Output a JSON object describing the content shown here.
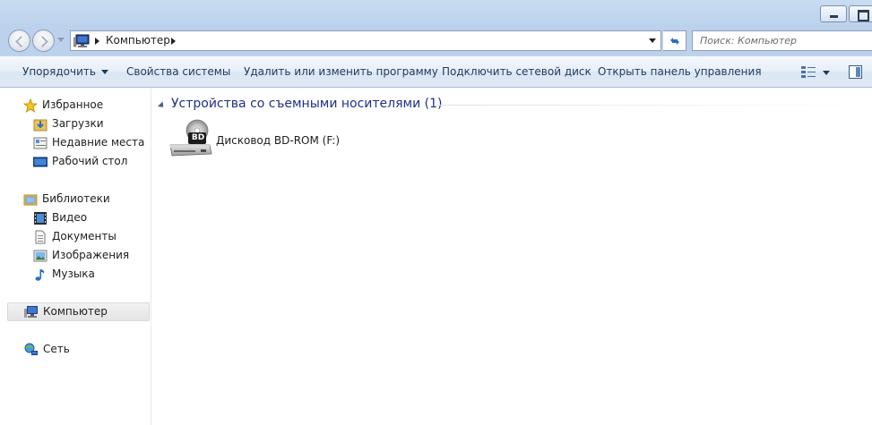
{
  "address": {
    "path_segment": "Компьютер",
    "search_placeholder": "Поиск: Компьютер"
  },
  "toolbar": {
    "organize": "Упорядочить",
    "system_properties": "Свойства системы",
    "uninstall": "Удалить или изменить программу",
    "map_drive": "Подключить сетевой диск",
    "control_panel": "Открыть панель управления"
  },
  "sidebar": {
    "favorites": {
      "label": "Избранное",
      "items": [
        "Загрузки",
        "Недавние места",
        "Рабочий стол"
      ]
    },
    "libraries": {
      "label": "Библиотеки",
      "items": [
        "Видео",
        "Документы",
        "Изображения",
        "Музыка"
      ]
    },
    "computer": "Компьютер",
    "network": "Сеть"
  },
  "content": {
    "group_title": "Устройства со съемными носителями (1)",
    "drive_label": "Дисковод BD-ROM (F:)",
    "drive_badge": "BD"
  },
  "colors": {
    "group_title": "#1e3287",
    "toolbar_text": "#1e395b",
    "frame": "#bcd2ec"
  }
}
